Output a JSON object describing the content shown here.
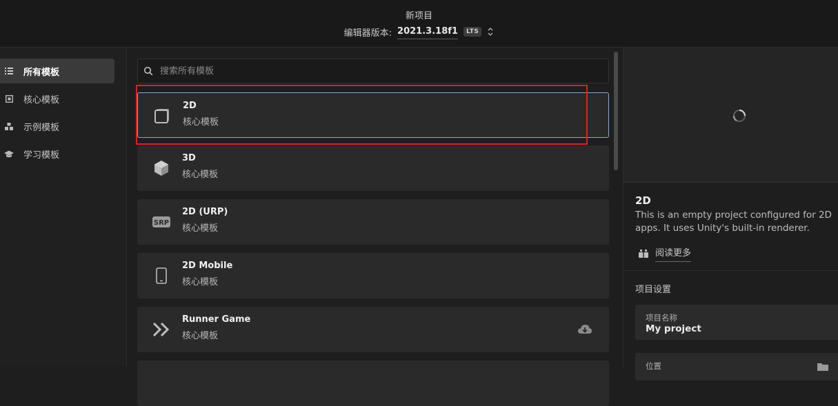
{
  "header": {
    "title": "新项目",
    "version_label": "编辑器版本:",
    "version_value": "2021.3.18f1",
    "badge": "LTS"
  },
  "sidebar": {
    "items": [
      {
        "label": "所有模板",
        "icon": "list-icon",
        "active": true
      },
      {
        "label": "核心模板",
        "icon": "core-square-icon",
        "active": false
      },
      {
        "label": "示例模板",
        "icon": "sample-blocks-icon",
        "active": false
      },
      {
        "label": "学习模板",
        "icon": "graduation-cap-icon",
        "active": false
      }
    ]
  },
  "search": {
    "placeholder": "搜索所有模板"
  },
  "templates": [
    {
      "name": "2D",
      "category": "核心模板",
      "icon": "square-2d-icon",
      "selected": true
    },
    {
      "name": "3D",
      "category": "核心模板",
      "icon": "cube-3d-icon"
    },
    {
      "name": "2D (URP)",
      "category": "核心模板",
      "icon": "srp-icon",
      "icon_text": "SRP"
    },
    {
      "name": "2D Mobile",
      "category": "核心模板",
      "icon": "mobile-phone-icon"
    },
    {
      "name": "Runner Game",
      "category": "核心模板",
      "icon": "runner-chevrons-icon",
      "downloadable": true
    }
  ],
  "details": {
    "title": "2D",
    "description": "This is an empty project configured for 2D apps. It uses Unity's built-in renderer.",
    "read_more": "阅读更多"
  },
  "settings": {
    "title": "项目设置",
    "project_name_label": "项目名称",
    "project_name_value": "My project",
    "location_label": "位置"
  },
  "colors": {
    "selection_border": "#8aa9d6",
    "highlight_box": "#e02020"
  }
}
